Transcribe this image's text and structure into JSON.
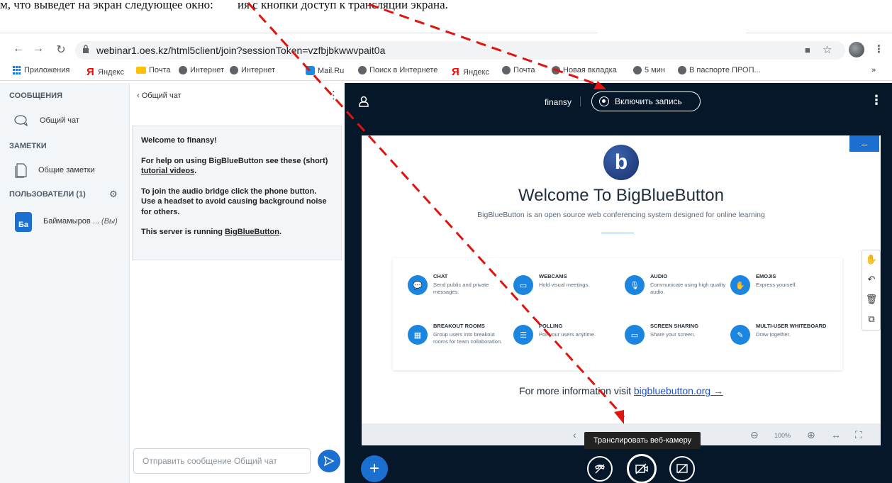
{
  "doc_top": {
    "text_left": "м, что выведет на экран следующее окно:",
    "text_mid": "ия с кнопки доступ к трансляции экрана."
  },
  "browser": {
    "url": "webinar1.oes.kz/html5client/join?sessionToken=vzfbjbkwwvpait0a",
    "bookmarks": [
      "Приложения",
      "Яндекс",
      "Почта",
      "Интернет",
      "Интернет",
      "Mail.Ru",
      "Поиск в Интернете",
      "Яндекс",
      "Почта",
      "Новая вкладка",
      "5 мин",
      "В паспорте ПРОП..."
    ],
    "overflow": "»"
  },
  "userlist": {
    "messages_title": "СООБЩЕНИЯ",
    "public_chat": "Общий чат",
    "notes_title": "ЗАМЕТКИ",
    "shared_notes": "Общие заметки",
    "users_title": "ПОЛЬЗОВАТЕЛИ (1)",
    "user_avatar": "Ба",
    "user_name": "Баймамыров ...",
    "user_you": "(Вы)"
  },
  "chat": {
    "header": "Общий чат",
    "welcome": "Welcome to finansy!",
    "help_1": "For help on using BigBlueButton see these (short) ",
    "help_link": "tutorial videos",
    "help_end": ".",
    "audio_text": "To join the audio bridge click the phone button. Use a headset to avoid causing background noise for others.",
    "server_text": "This server is running ",
    "server_link": "BigBlueButton",
    "server_end": ".",
    "input_placeholder": "Отправить сообщение Общий чат"
  },
  "header": {
    "conference": "finansy",
    "record_label": "Включить запись"
  },
  "slide": {
    "title": "Welcome To BigBlueButton",
    "subtitle": "BigBlueButton is an open source web conferencing system designed for online learning",
    "features": [
      {
        "title": "CHAT",
        "desc": "Send public and private messages."
      },
      {
        "title": "WEBCAMS",
        "desc": "Hold visual meetings."
      },
      {
        "title": "AUDIO",
        "desc": "Communicate using high quality audio."
      },
      {
        "title": "EMOJIS",
        "desc": "Express yourself."
      },
      {
        "title": "BREAKOUT ROOMS",
        "desc": "Group users into breakout rooms for team collaboration."
      },
      {
        "title": "POLLING",
        "desc": "Poll your users anytime."
      },
      {
        "title": "SCREEN SHARING",
        "desc": "Share your screen."
      },
      {
        "title": "MULTI-USER WHITEBOARD",
        "desc": "Draw together."
      }
    ],
    "more_prefix": "For more information visit ",
    "more_link": "bigbluebutton.org →",
    "logo_letter": "b"
  },
  "toolbar": {
    "zoom": "100%",
    "tooltip": "Транслировать веб-камеру"
  },
  "colors": {
    "primary": "#1b6fd1",
    "dark_bg": "#06172a",
    "arrow": "#e0140e"
  }
}
